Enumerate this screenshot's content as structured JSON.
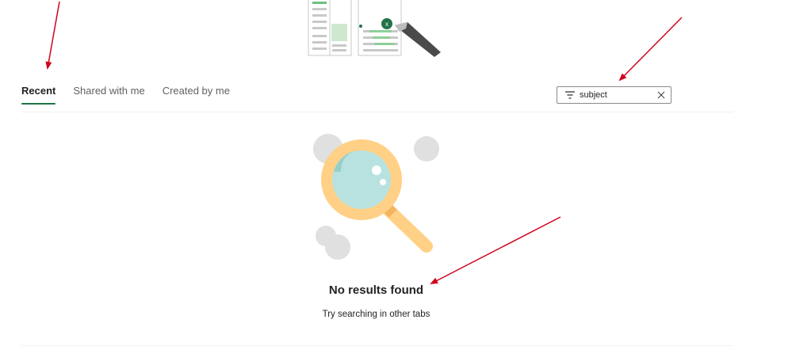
{
  "tabs": [
    {
      "label": "Recent",
      "active": true
    },
    {
      "label": "Shared with me",
      "active": false
    },
    {
      "label": "Created by me",
      "active": false
    }
  ],
  "search": {
    "value": "subject",
    "icon": "filter-icon",
    "clear_icon": "close-icon"
  },
  "empty_state": {
    "title": "No results found",
    "subtitle": "Try searching in other tabs",
    "illustration": "magnifying-glass-illustration"
  },
  "colors": {
    "accent": "#217346",
    "annotation_arrow": "#d0021b"
  }
}
